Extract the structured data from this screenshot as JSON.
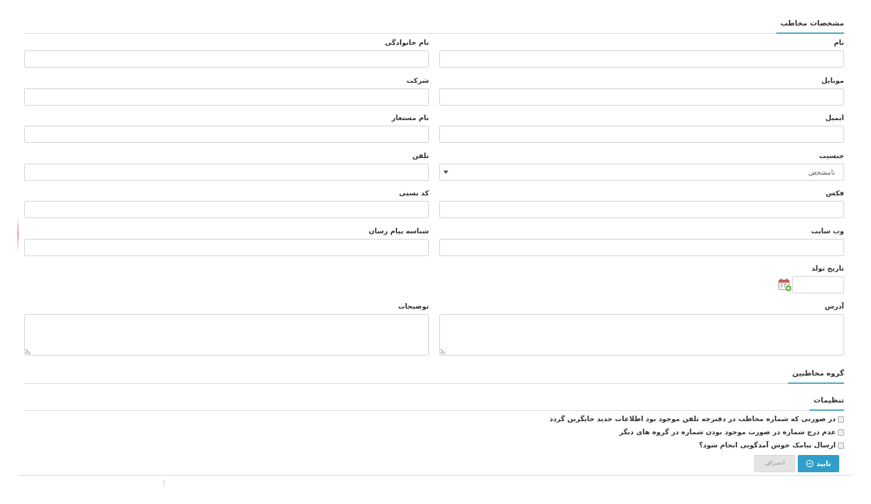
{
  "contact_details": {
    "title": "مشخصات مخاطب",
    "fields": [
      {
        "kind": "text",
        "label": "نام"
      },
      {
        "kind": "text",
        "label": "نام خانوادگی"
      },
      {
        "kind": "text",
        "label": "موبایل"
      },
      {
        "kind": "text",
        "label": "شرکت"
      },
      {
        "kind": "text",
        "label": "ایمیل"
      },
      {
        "kind": "text",
        "label": "نام مستعار"
      },
      {
        "kind": "select",
        "label": "جنسیت",
        "value": "نامشخص"
      },
      {
        "kind": "text",
        "label": "تلفن"
      },
      {
        "kind": "text",
        "label": "فکس"
      },
      {
        "kind": "text",
        "label": "کد پستی"
      },
      {
        "kind": "text",
        "label": "وب سایت"
      },
      {
        "kind": "text",
        "label": "شناسه پیام رسان"
      },
      {
        "kind": "date",
        "label": "تاریخ تولد"
      },
      {
        "kind": "textarea",
        "label": "آدرس"
      },
      {
        "kind": "textarea",
        "label": "توضیحات"
      }
    ]
  },
  "contact_groups": {
    "title": "گروه مخاطبین"
  },
  "settings": {
    "title": "تنظیمات",
    "options": [
      {
        "label": "در صورتی که شماره مخاطب در دفترچه تلفن موجود بود اطلاعات جدید جایگزین گردد",
        "checked": false
      },
      {
        "label": "عدم درج شماره در صورت موجود بودن شماره در گروه های دیگر",
        "checked": false
      },
      {
        "label": "ارسال پیامک خوش آمدگویی انجام شود؟",
        "checked": false
      }
    ]
  },
  "buttons": [
    {
      "kind": "primary",
      "label": "تایید"
    },
    {
      "kind": "secondary",
      "label": "انصراف"
    }
  ]
}
